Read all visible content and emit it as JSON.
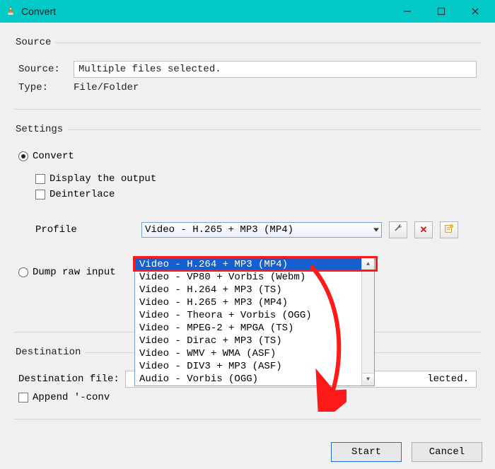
{
  "window": {
    "title": "Convert"
  },
  "source": {
    "legend": "Source",
    "label": "Source:",
    "value": "Multiple files selected.",
    "type_label": "Type:",
    "type_value": "File/Folder"
  },
  "settings": {
    "legend": "Settings",
    "convert_label": "Convert",
    "display_output_label": "Display the output",
    "deinterlace_label": "Deinterlace",
    "profile_label": "Profile",
    "profile_selected": "Video - H.265 + MP3 (MP4)",
    "profile_options": [
      "Video - H.264 + MP3 (MP4)",
      "Video - VP80 + Vorbis (Webm)",
      "Video - H.264 + MP3 (TS)",
      "Video - H.265 + MP3 (MP4)",
      "Video - Theora + Vorbis (OGG)",
      "Video - MPEG-2 + MPGA (TS)",
      "Video - Dirac + MP3 (TS)",
      "Video - WMV + WMA (ASF)",
      "Video - DIV3 + MP3 (ASF)",
      "Audio - Vorbis (OGG)"
    ],
    "dump_label": "Dump raw input"
  },
  "destination": {
    "legend": "Destination",
    "file_label": "Destination file:",
    "file_value_suffix": "lected.",
    "append_label": "Append '-conv"
  },
  "buttons": {
    "start": "Start",
    "cancel": "Cancel"
  },
  "icons": {
    "wrench": "🔧",
    "delete": "✕",
    "new": "new"
  }
}
